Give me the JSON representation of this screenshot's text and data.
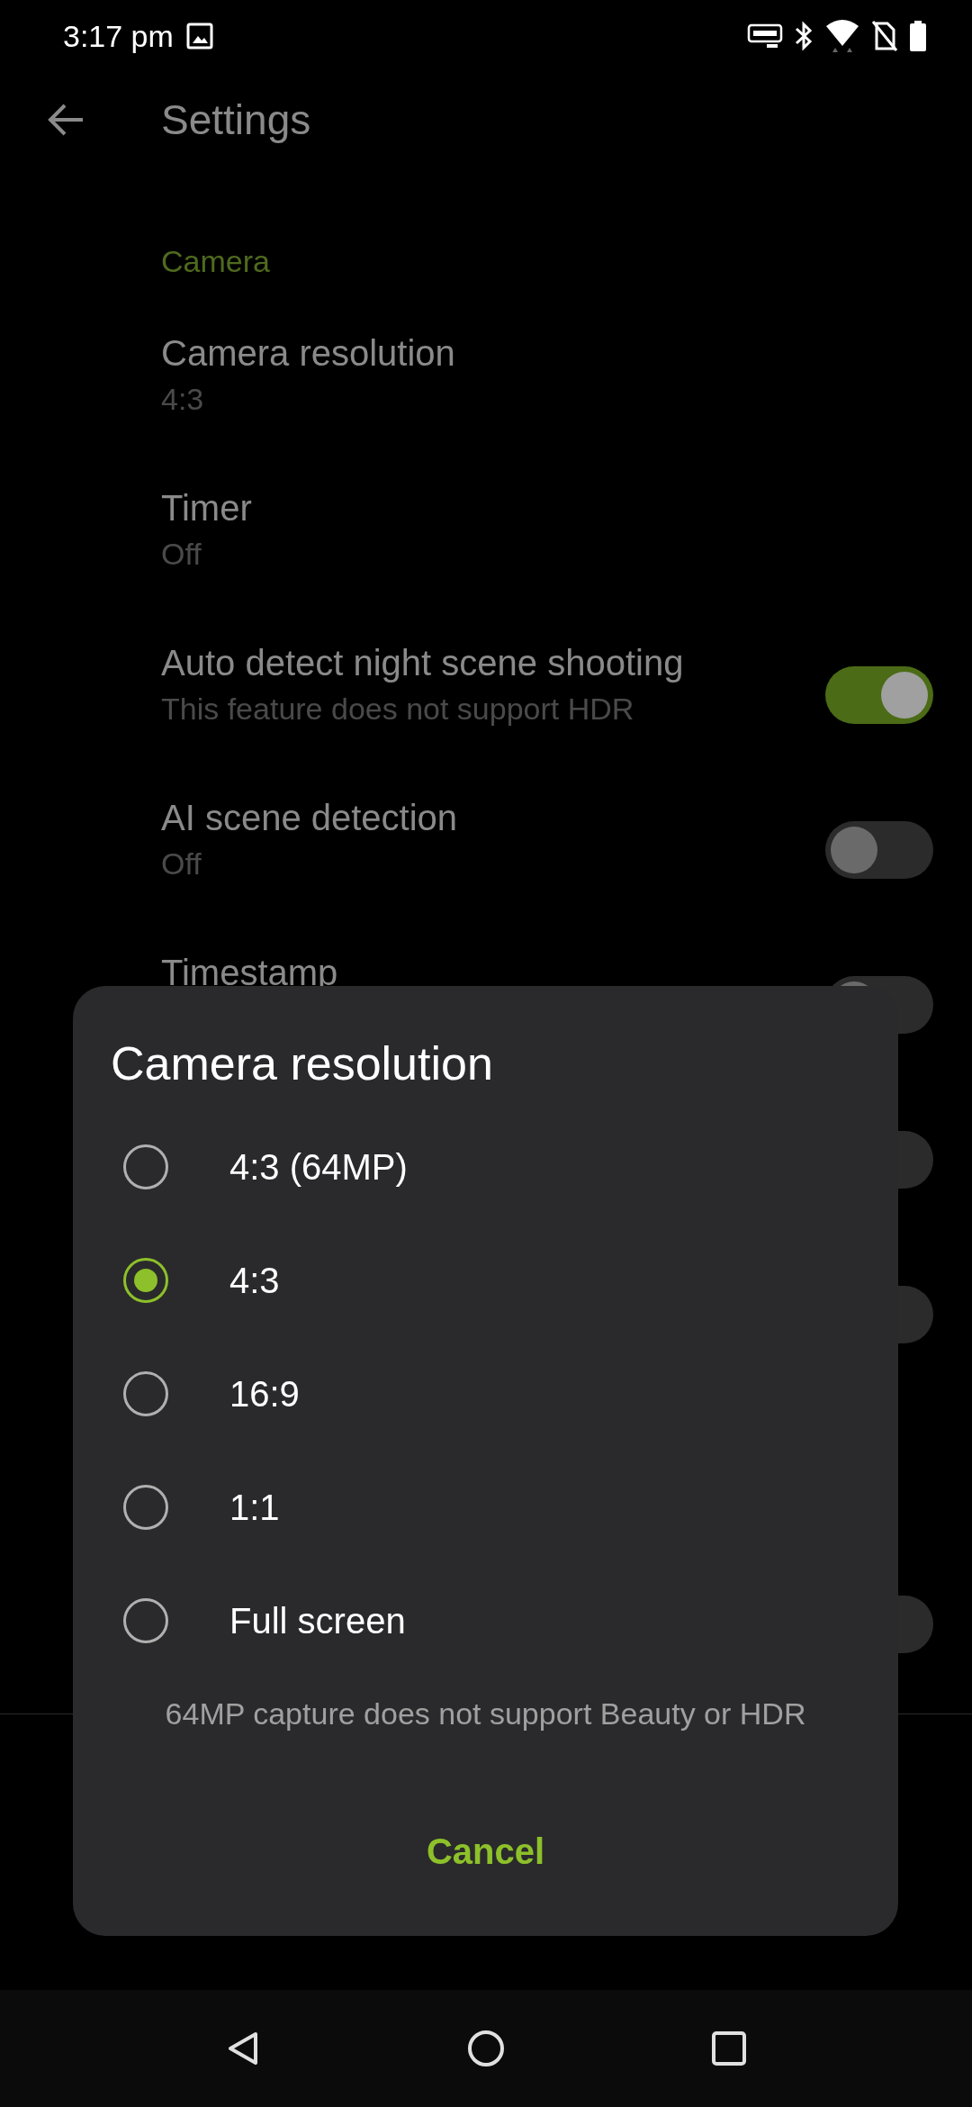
{
  "status_bar": {
    "time": "3:17 pm"
  },
  "toolbar": {
    "title": "Settings"
  },
  "settings": {
    "category": "Camera",
    "items": [
      {
        "kind": "plain",
        "title": "Camera resolution",
        "summary": "4:3"
      },
      {
        "kind": "plain",
        "title": "Timer",
        "summary": "Off"
      },
      {
        "kind": "switch",
        "title": "Auto detect night scene shooting",
        "summary": "This feature does not support HDR",
        "on": true
      },
      {
        "kind": "switch",
        "title": "AI scene detection",
        "summary": "Off",
        "on": false
      },
      {
        "kind": "switch",
        "title": "Timestamp",
        "on": false
      },
      {
        "kind": "switch",
        "on": false
      },
      {
        "kind": "switch",
        "on": false
      },
      {
        "kind": "switch",
        "on": false
      }
    ]
  },
  "dialog": {
    "title": "Camera resolution",
    "options": [
      {
        "label": "4:3 (64MP)",
        "selected": false
      },
      {
        "label": "4:3",
        "selected": true
      },
      {
        "label": "16:9",
        "selected": false
      },
      {
        "label": "1:1",
        "selected": false
      },
      {
        "label": "Full screen",
        "selected": false
      }
    ],
    "note": "64MP capture does not support Beauty or HDR",
    "button": "Cancel"
  }
}
